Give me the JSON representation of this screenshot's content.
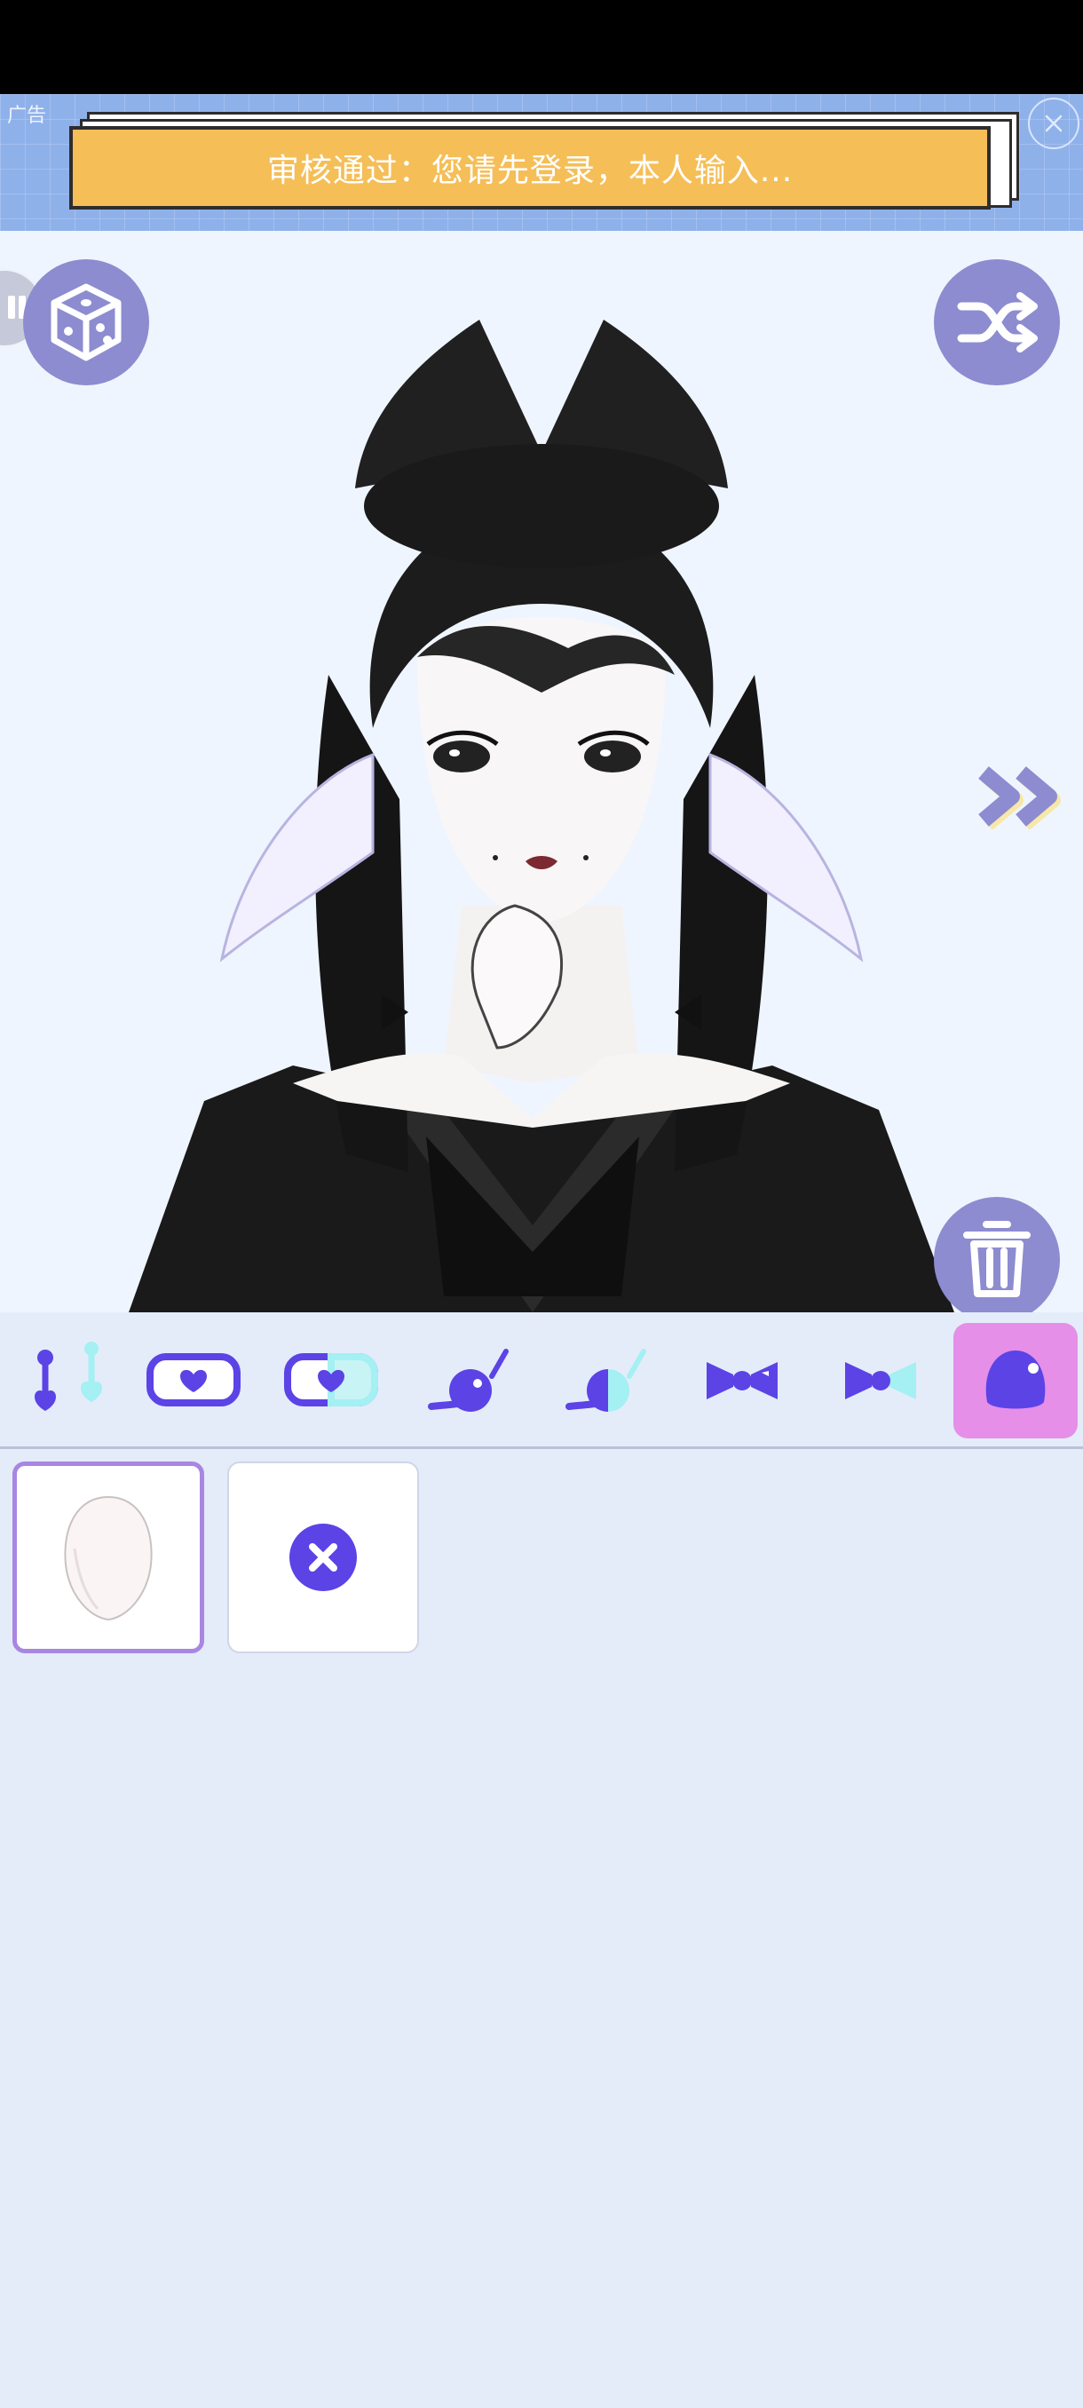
{
  "ad": {
    "tag": "广告",
    "headline": "审核通过：您请先登录，本人输入..."
  },
  "canvas": {
    "description_icons": [
      "dice-icon",
      "shuffle-icon",
      "double-chevron-right-icon",
      "trash-icon"
    ]
  },
  "toolbar": {
    "items": [
      {
        "name": "hairpin-icon",
        "active": false
      },
      {
        "name": "heart-clip-icon",
        "active": false
      },
      {
        "name": "half-heart-clip-icon",
        "active": false
      },
      {
        "name": "ball-pin-icon",
        "active": false
      },
      {
        "name": "half-ball-pin-icon",
        "active": false
      },
      {
        "name": "bow-icon",
        "active": false
      },
      {
        "name": "half-bow-icon",
        "active": false
      },
      {
        "name": "face-base-icon",
        "active": true
      }
    ]
  },
  "options": [
    {
      "name": "face-shape-option",
      "selected": true
    },
    {
      "name": "remove-option",
      "selected": false
    }
  ],
  "colors": {
    "accent": "#5b43e6",
    "button": "#8d8cd0",
    "active_tab": "#e58fe9",
    "ad_card": "#f5be57",
    "panel": "#e4ecfa"
  }
}
